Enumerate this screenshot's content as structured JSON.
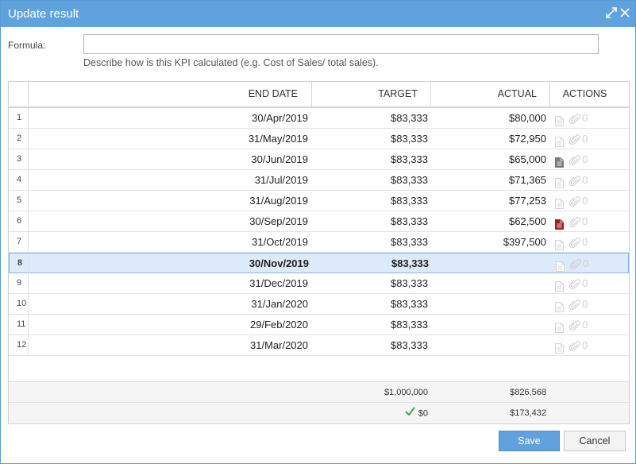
{
  "window": {
    "title": "Update result",
    "maximize_icon": "expand-arrows-icon",
    "close_icon": "close-icon"
  },
  "formula": {
    "label": "Formula:",
    "value": "",
    "placeholder": "",
    "hint": "Describe how is this KPI calculated (e.g. Cost of Sales/ total sales)."
  },
  "grid": {
    "columns": {
      "number": "",
      "end_date": "END DATE",
      "target": "TARGET",
      "actual": "ACTUAL",
      "actions": "ACTIONS"
    },
    "rows": [
      {
        "num": "1",
        "end_date": "30/Apr/2019",
        "target": "$83,333",
        "actual": "$80,000",
        "doc": "none",
        "attachments": "0"
      },
      {
        "num": "2",
        "end_date": "31/May/2019",
        "target": "$83,333",
        "actual": "$72,950",
        "doc": "none",
        "attachments": "0"
      },
      {
        "num": "3",
        "end_date": "30/Jun/2019",
        "target": "$83,333",
        "actual": "$65,000",
        "doc": "grey",
        "attachments": "0"
      },
      {
        "num": "4",
        "end_date": "31/Jul/2019",
        "target": "$83,333",
        "actual": "$71,365",
        "doc": "none",
        "attachments": "0"
      },
      {
        "num": "5",
        "end_date": "31/Aug/2019",
        "target": "$83,333",
        "actual": "$77,253",
        "doc": "none",
        "attachments": "0"
      },
      {
        "num": "6",
        "end_date": "30/Sep/2019",
        "target": "$83,333",
        "actual": "$62,500",
        "doc": "red",
        "attachments": "0"
      },
      {
        "num": "7",
        "end_date": "31/Oct/2019",
        "target": "$83,333",
        "actual": "$397,500",
        "doc": "none",
        "attachments": "0"
      },
      {
        "num": "8",
        "end_date": "30/Nov/2019",
        "target": "$83,333",
        "actual": "",
        "doc": "none",
        "attachments": "0",
        "selected": true
      },
      {
        "num": "9",
        "end_date": "31/Dec/2019",
        "target": "$83,333",
        "actual": "",
        "doc": "none",
        "attachments": "0"
      },
      {
        "num": "10",
        "end_date": "31/Jan/2020",
        "target": "$83,333",
        "actual": "",
        "doc": "none",
        "attachments": "0"
      },
      {
        "num": "11",
        "end_date": "29/Feb/2020",
        "target": "$83,333",
        "actual": "",
        "doc": "none",
        "attachments": "0"
      },
      {
        "num": "12",
        "end_date": "31/Mar/2020",
        "target": "$83,333",
        "actual": "",
        "doc": "none",
        "attachments": "0"
      }
    ],
    "totals": {
      "target": "$1,000,000",
      "actual": "$826,568"
    },
    "variance": {
      "target": "$0",
      "target_icon": "checkmark-icon",
      "actual": "$173,432"
    }
  },
  "buttons": {
    "save": "Save",
    "cancel": "Cancel"
  },
  "colors": {
    "titlebar": "#5fa2dd",
    "selected_row": "#ddeafa",
    "doc_grey": "#7a7a7a",
    "doc_red": "#a31d24",
    "doc_faint": "#d4d4d4",
    "check_green": "#3aa64b"
  }
}
